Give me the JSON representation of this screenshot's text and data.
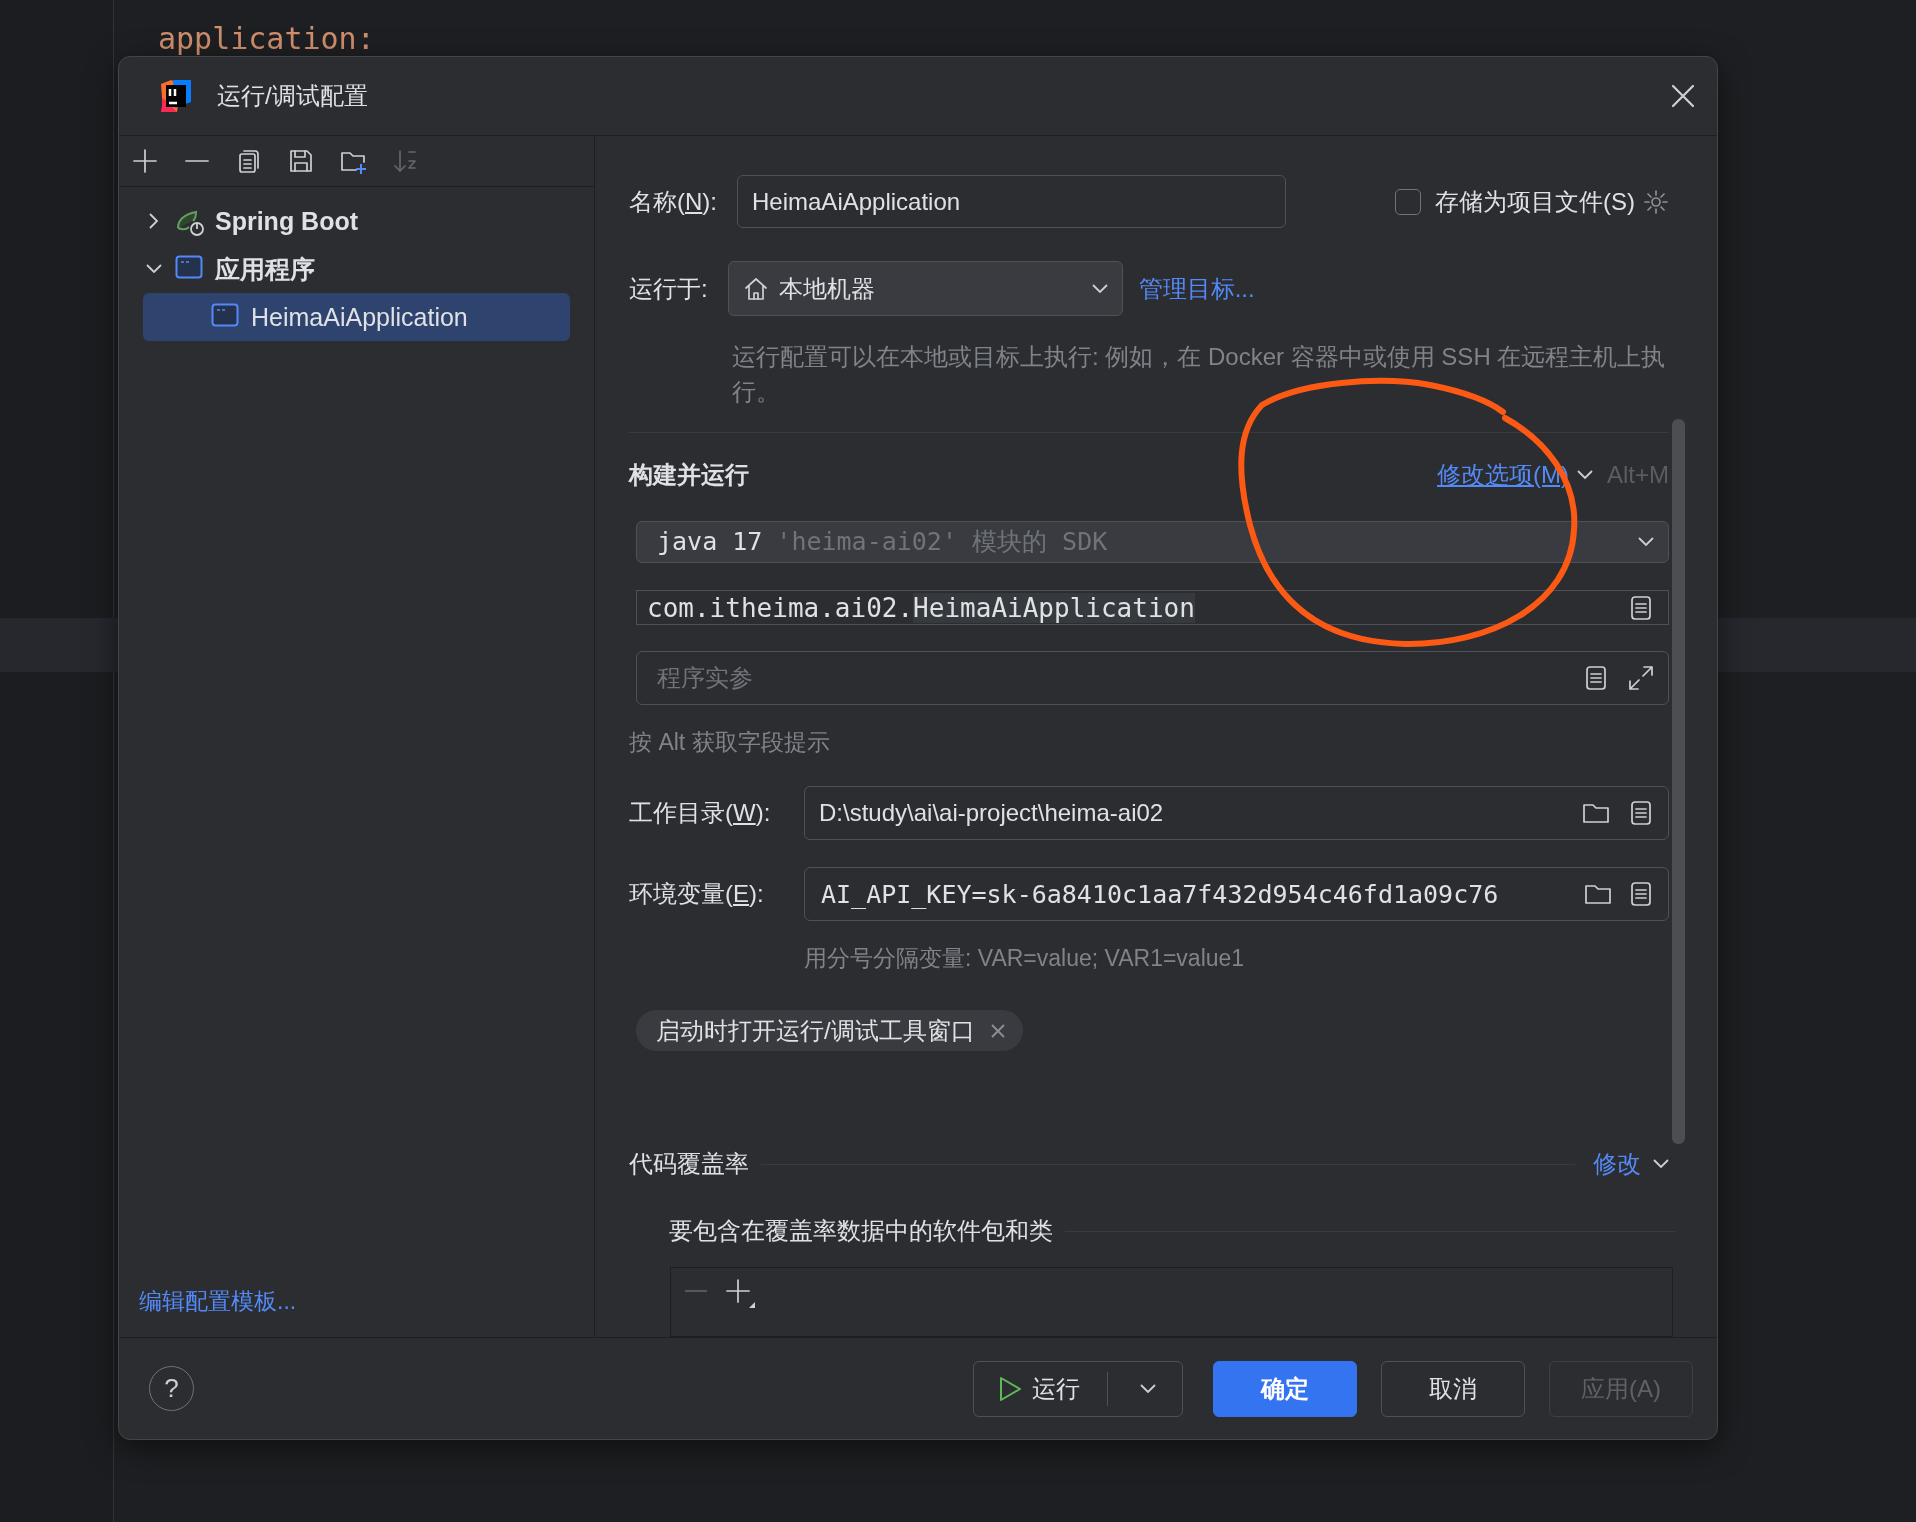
{
  "editor": {
    "code_lines": [
      "application:"
    ]
  },
  "dialog": {
    "title": "运行/调试配置",
    "toolbar": [
      {
        "kind": "add",
        "disabled": false
      },
      {
        "kind": "remove",
        "disabled": false
      },
      {
        "kind": "copy",
        "disabled": false
      },
      {
        "kind": "save",
        "disabled": false
      },
      {
        "kind": "new-folder",
        "disabled": false
      },
      {
        "kind": "sort",
        "disabled": true
      }
    ],
    "tree": [
      {
        "label": "Spring Boot",
        "kind": "spring",
        "expanded": false,
        "selected": false
      },
      {
        "label": "应用程序",
        "kind": "application",
        "expanded": true,
        "selected": false,
        "children": [
          {
            "label": "HeimaAiApplication",
            "kind": "application",
            "selected": true
          }
        ]
      }
    ],
    "template_link": "编辑配置模板...",
    "form": {
      "name": {
        "label_start": "名称(",
        "mnemonic": "N",
        "label_end": "):",
        "value": "HeimaAiApplication"
      },
      "store_as_project_file": {
        "label": "存储为项目文件(S)",
        "checked": false
      },
      "run_on": {
        "label": "运行于:",
        "value": "本地机器",
        "link": "管理目标..."
      },
      "run_on_hint": "运行配置可以在本地或目标上执行: 例如，在 Docker 容器中或使用 SSH 在远程主机上执行。",
      "build_and_run": {
        "title": "构建并运行",
        "modify_link": "修改选项(M)",
        "shortcut": "Alt+M",
        "sdk": {
          "value": "java 17",
          "detail": "'heima-ai02' 模块的 SDK"
        },
        "main_class": {
          "prefix": "com.itheima.ai02.",
          "highlight": "HeimaAiApplication"
        },
        "program_args": {
          "placeholder": "程序实参"
        },
        "alt_hint": "按 Alt 获取字段提示",
        "working_dir": {
          "label_start": "工作目录(",
          "mnemonic": "W",
          "label_end": "):",
          "value": "D:\\study\\ai\\ai-project\\heima-ai02"
        },
        "env_vars": {
          "label_start": "环境变量(",
          "mnemonic": "E",
          "label_end": "):",
          "value": "AI_API_KEY=sk-6a8410c1aa7f432d954c46fd1a09c76"
        },
        "env_hint": "用分号分隔变量: VAR=value; VAR1=value1",
        "option_chips": [
          {
            "label": "启动时打开运行/调试工具窗口"
          }
        ]
      },
      "coverage": {
        "title": "代码覆盖率",
        "modify_link": "修改",
        "include_title": "要包含在覆盖率数据中的软件包和类"
      }
    },
    "help": "?",
    "buttons": [
      {
        "kind": "run",
        "label": "运行",
        "disabled": false
      },
      {
        "kind": "primary",
        "label": "确定",
        "disabled": false
      },
      {
        "kind": "normal",
        "label": "取消",
        "disabled": false
      },
      {
        "kind": "normal",
        "label": "应用(A)",
        "disabled": true
      }
    ]
  },
  "annotations": [
    {
      "kind": "freehand-circle"
    }
  ]
}
